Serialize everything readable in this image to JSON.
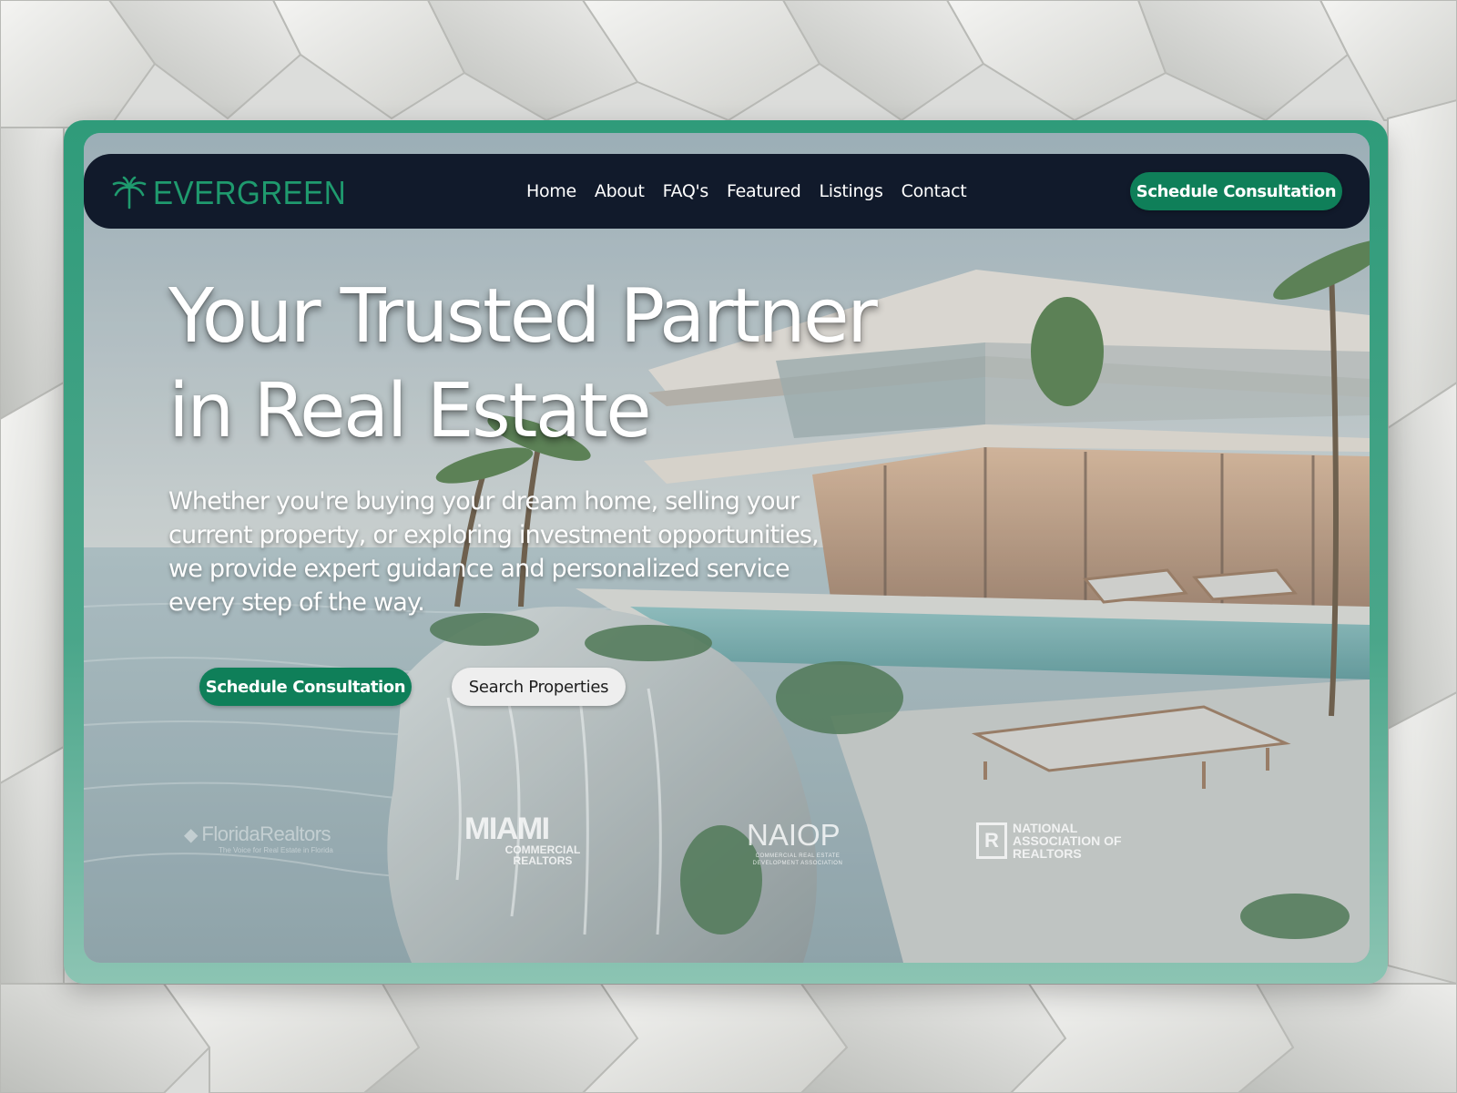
{
  "brand": {
    "name": "EVERGREEN",
    "color": "#1f9a6e"
  },
  "nav": {
    "links": [
      "Home",
      "About",
      "FAQ's",
      "Featured",
      "Listings",
      "Contact"
    ],
    "cta": "Schedule Consultation"
  },
  "hero": {
    "title_line1": "Your Trusted Partner",
    "title_line2": "in Real Estate",
    "subtitle": "Whether you're buying your dream home, selling your current property, or exploring investment opportunities, we provide expert guidance and personalized service every step of the way.",
    "primary_button": "Schedule Consultation",
    "secondary_button": "Search Properties"
  },
  "partners": {
    "florida_realtors": {
      "name": "FloridaRealtors",
      "tagline": "The Voice for Real Estate in Florida"
    },
    "miami": {
      "name": "MIAMI",
      "line1": "COMMERCIAL",
      "line2": "REALTORS"
    },
    "naiop": {
      "name": "NAIOP",
      "tagline": "COMMERCIAL REAL ESTATE DEVELOPMENT ASSOCIATION"
    },
    "nar": {
      "mark": "R",
      "line1": "NATIONAL",
      "line2": "ASSOCIATION OF",
      "line3": "REALTORS"
    }
  },
  "colors": {
    "accent": "#0f7f59",
    "nav_bg": "#111a2b",
    "frame": "#2f9b7a"
  },
  "icons": {
    "brand": "palm-tree-icon"
  }
}
